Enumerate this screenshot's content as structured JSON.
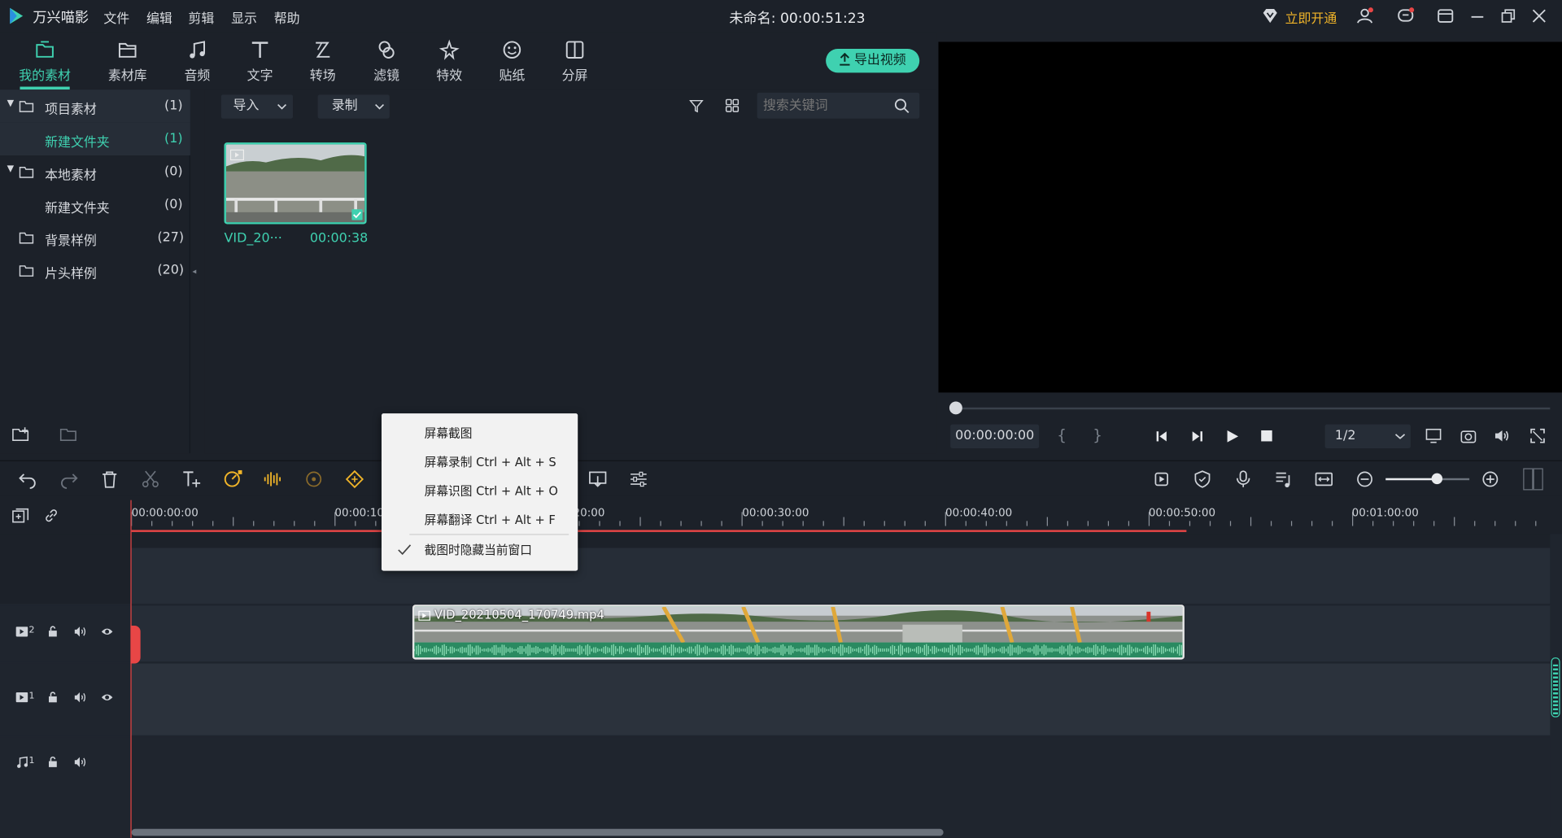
{
  "app": {
    "name": "万兴喵影",
    "title": "未命名: 00:00:51:23",
    "vip_label": "立即开通",
    "menu": [
      "文件",
      "编辑",
      "剪辑",
      "显示",
      "帮助"
    ]
  },
  "toolbar": {
    "tabs": [
      {
        "label": "我的素材",
        "icon": "folder-media-icon"
      },
      {
        "label": "素材库",
        "icon": "library-icon"
      },
      {
        "label": "音频",
        "icon": "music-icon"
      },
      {
        "label": "文字",
        "icon": "text-icon"
      },
      {
        "label": "转场",
        "icon": "transition-icon"
      },
      {
        "label": "滤镜",
        "icon": "filter-icon"
      },
      {
        "label": "特效",
        "icon": "effects-icon"
      },
      {
        "label": "贴纸",
        "icon": "sticker-icon"
      },
      {
        "label": "分屏",
        "icon": "split-screen-icon"
      }
    ],
    "export_label": "导出视频"
  },
  "tree": [
    {
      "label": "项目素材",
      "count": "(1)"
    },
    {
      "label": "新建文件夹",
      "count": "(1)"
    },
    {
      "label": "本地素材",
      "count": "(0)"
    },
    {
      "label": "新建文件夹",
      "count": "(0)"
    },
    {
      "label": "背景样例",
      "count": "(27)"
    },
    {
      "label": "片头样例",
      "count": "(20)"
    }
  ],
  "media": {
    "import_label": "导入",
    "record_label": "录制",
    "search_placeholder": "搜索关键词",
    "clip": {
      "name": "VID_20···",
      "duration": "00:00:38"
    }
  },
  "player": {
    "timecode": "00:00:00:00",
    "mark_in": "{",
    "mark_out": "}",
    "quality": "1/2"
  },
  "context_menu": [
    {
      "label": "屏幕截图",
      "checked": false
    },
    {
      "label": "屏幕录制 Ctrl + Alt + S",
      "checked": false
    },
    {
      "label": "屏幕识图 Ctrl + Alt + O",
      "checked": false
    },
    {
      "label": "屏幕翻译 Ctrl + Alt + F",
      "checked": false
    },
    {
      "label": "截图时隐藏当前窗口",
      "checked": true
    }
  ],
  "timeline": {
    "ruler": [
      "00:00:00:00",
      "00:00:10:00",
      "00:00:20:00",
      "00:00:30:00",
      "00:00:40:00",
      "00:00:50:00",
      "00:01:00:00"
    ],
    "clip_name": "VID_20210504_170749.mp4",
    "tracks": [
      {
        "label": "2"
      },
      {
        "label": "1"
      },
      {
        "label": "1"
      }
    ]
  },
  "colors": {
    "accent": "#3fd1b0",
    "playhead": "#e84646",
    "clip_border": "#e6e6e6",
    "audio_wave": "#2e9a6c",
    "vip": "#f0b429"
  }
}
